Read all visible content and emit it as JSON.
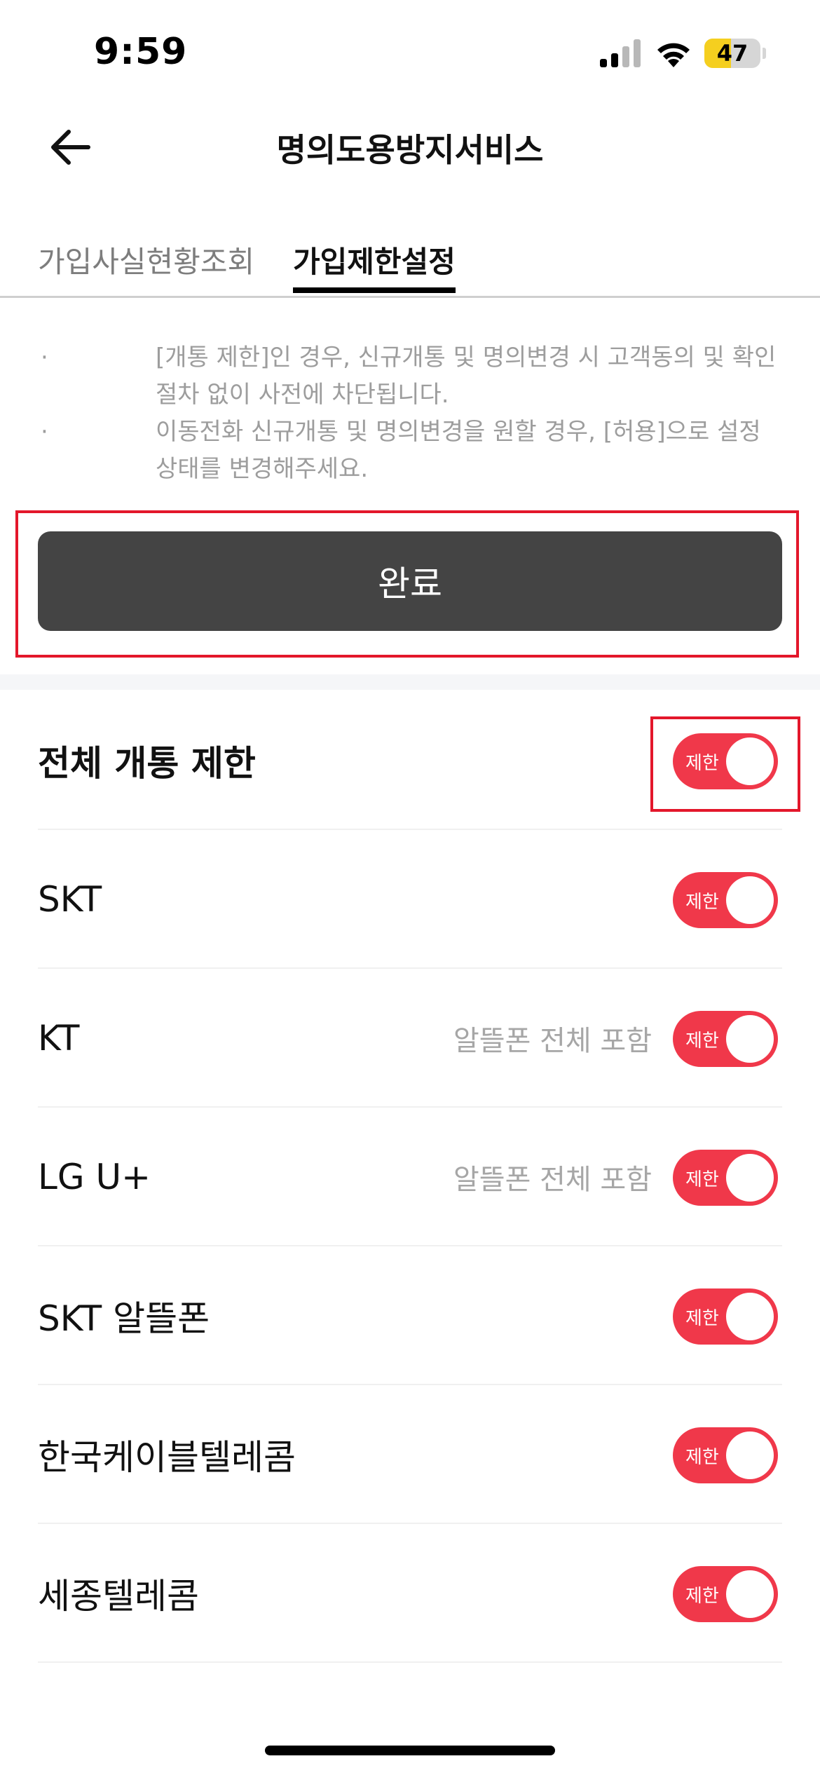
{
  "status_bar": {
    "time": "9:59",
    "battery_level": "47",
    "battery_percent": 47
  },
  "header": {
    "title": "명의도용방지서비스"
  },
  "tabs": [
    {
      "label": "가입사실현황조회",
      "active": false
    },
    {
      "label": "가입제한설정",
      "active": true
    }
  ],
  "notices": [
    {
      "bullet": "·",
      "text": "[개통 제한]인 경우, 신규개통 및 명의변경 시 고객동의 및 확인절차 없이 사전에 차단됩니다."
    },
    {
      "bullet": "·",
      "text": "이동전화 신규개통 및 명의변경을 원할 경우, [허용]으로 설정 상태를 변경해주세요."
    }
  ],
  "done_button": {
    "label": "완료"
  },
  "toggle_state_label": "제한",
  "carriers": [
    {
      "label": "전체 개통 제한",
      "sub": "",
      "enabled": true
    },
    {
      "label": "SKT",
      "sub": "",
      "enabled": true
    },
    {
      "label": "KT",
      "sub": "알뜰폰 전체 포함",
      "enabled": true
    },
    {
      "label": "LG U+",
      "sub": "알뜰폰 전체 포함",
      "enabled": true
    },
    {
      "label": "SKT 알뜰폰",
      "sub": "",
      "enabled": true
    },
    {
      "label": "한국케이블텔레콤",
      "sub": "",
      "enabled": true
    },
    {
      "label": "세종텔레콤",
      "sub": "",
      "enabled": true
    }
  ],
  "colors": {
    "accent": "#f0384a",
    "button": "#444444",
    "highlight": "#e3172b"
  }
}
